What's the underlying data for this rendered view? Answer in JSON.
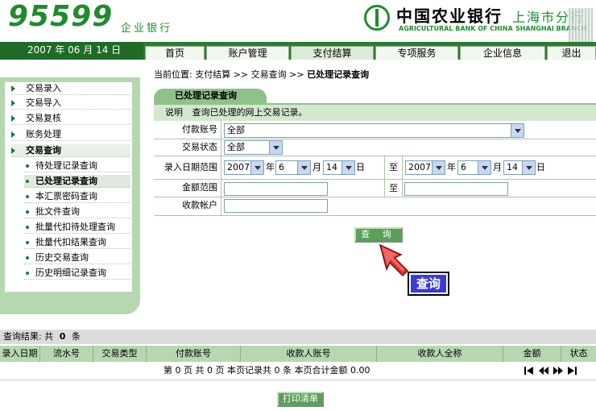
{
  "brand": {
    "logo_number": "95599",
    "logo_sub": "企业银行",
    "bank_name": "中国农业银行",
    "branch_name": "上海市分行",
    "bank_en": "AGRICULTURAL BANK OF CHINA",
    "branch_en": "SHANGHAI BRANCH"
  },
  "date_bar": {
    "text": "2007 年  06 月  14 日"
  },
  "nav": {
    "tabs": [
      "首页",
      "账户管理",
      "支付结算",
      "专项服务",
      "企业信息",
      "退出"
    ],
    "active": "支付结算"
  },
  "sidebar": {
    "items": [
      "交易录入",
      "交易导入",
      "交易复核",
      "账务处理",
      "交易查询"
    ],
    "active_item": "交易查询",
    "sub_items": [
      "待处理记录查询",
      "已处理记录查询",
      "本汇票密码查询",
      "批文件查询",
      "批量代扣待处理查询",
      "批量代扣结果查询",
      "历史交易查询",
      "历史明细记录查询"
    ],
    "active_sub_item": "已处理记录查询"
  },
  "breadcrumb": {
    "prefix": "当前位置:",
    "path1": "支付结算",
    "sep1": ">>",
    "path2": "交易查询",
    "sep2": ">>",
    "current": "已处理记录查询"
  },
  "panel": {
    "title": "已处理记录查询",
    "desc_label": "说明",
    "desc_text": "查询已处理的网上交易记录。"
  },
  "form": {
    "payer_account_label": "付款账号",
    "payer_account_value": "全部",
    "status_label": "交易状态",
    "status_value": "全部",
    "date_range_label": "录入日期范围",
    "from_year": "2007",
    "from_month": "6",
    "from_day": "14",
    "to_label": "至",
    "to_year": "2007",
    "to_month": "6",
    "to_day": "14",
    "year_unit": "年",
    "month_unit": "月",
    "day_unit": "日",
    "amount_range_label": "金额范围",
    "amount_from": "",
    "amount_to": "",
    "payee_account_label": "收款帐户",
    "payee_account_value": ""
  },
  "query_button": {
    "label": "查 询"
  },
  "tooltip": {
    "text": "查询"
  },
  "results": {
    "summary_label": "查询结果: 共",
    "count": "0",
    "count_unit": "条",
    "columns": [
      "录入日期",
      "流水号",
      "交易类型",
      "付款账号",
      "收款人账号",
      "收款人全称",
      "金额",
      "状态"
    ],
    "pager_text": "第 0 页  共 0 页   本页记录共 0 条   本页合计金额 0.00"
  },
  "print_button": {
    "label": "打印清单"
  },
  "colors": {
    "brand_green": "#1f8b2e",
    "nav_green": "#2d7a34",
    "panel_green": "#8fc28a",
    "tooltip_blue": "#3b3bd8"
  }
}
